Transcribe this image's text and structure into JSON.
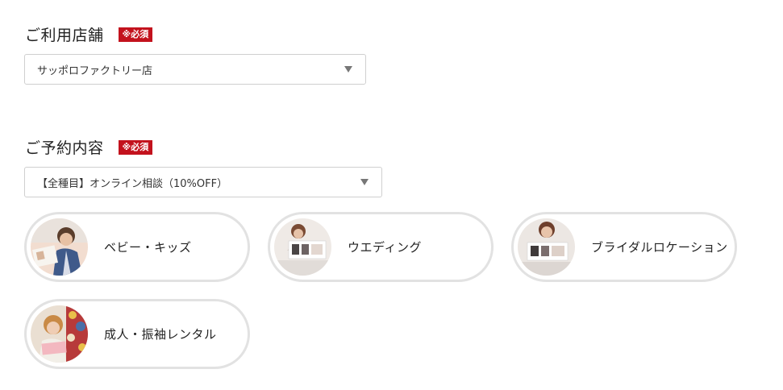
{
  "store": {
    "label": "ご利用店舗",
    "required": "※必須",
    "selected": "サッポロファクトリー店"
  },
  "reservation": {
    "label": "ご予約内容",
    "required": "※必須",
    "selected": "【全種目】オンライン相談（10%OFF）"
  },
  "categories": [
    {
      "label": "ベビー・キッズ"
    },
    {
      "label": "ウエディング"
    },
    {
      "label": "ブライダルロケーション"
    },
    {
      "label": "成人・振袖レンタル"
    }
  ],
  "colors": {
    "required_badge": "#c3121d",
    "card_border": "#e2e2e2"
  }
}
